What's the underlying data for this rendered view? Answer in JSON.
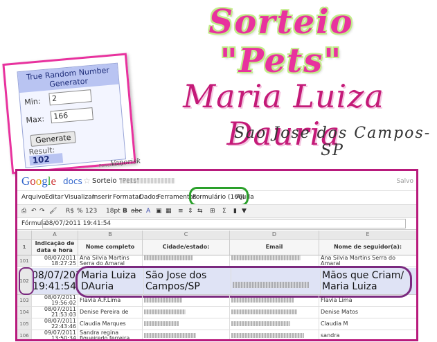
{
  "banner": {
    "title": "Sorteio \"Pets\"",
    "winner": "Maria Luiza Dauria",
    "city": "Sao Jose dos Campos-SP"
  },
  "rng": {
    "header": "True Random Number Generator",
    "min_label": "Min:",
    "min_value": "2",
    "max_label": "Max:",
    "max_value": "166",
    "button_label": "Generate",
    "result_label": "Result:",
    "result_value": "102",
    "powered": "Powered by",
    "signature": "Vanorisk"
  },
  "app": {
    "logo": [
      "G",
      "o",
      "o",
      "g",
      "l",
      "e"
    ],
    "docs": "docs",
    "doc_title": "Sorteio \"Pets\"",
    "saved": "Salvo"
  },
  "menu": [
    "Arquivo",
    "Editar",
    "Visualizar",
    "Inserir",
    "Formatar",
    "Dados",
    "Ferramentas",
    "Formulário (166)",
    "Ajuda"
  ],
  "toolbar": {
    "currency": "R$",
    "percent": "%",
    "num_format": "123",
    "font_size": "18pt",
    "bold": "B",
    "strike": "abc",
    "sigma": "Σ"
  },
  "formula": {
    "label": "Fórmula:",
    "value": "08/07/2011 19:41:54"
  },
  "columns": [
    "A",
    "B",
    "C",
    "D",
    "E"
  ],
  "headers": {
    "rownum": "1",
    "date": "Indicação de data e hora",
    "name": "Nome completo",
    "city": "Cidade/estado:",
    "email": "Email",
    "follower": "Nome de seguidor(a):"
  },
  "rows": [
    {
      "num": "101",
      "date": "08/07/2011 18:27:25",
      "name": "Ana Silvia Martins Serra do Amaral",
      "follower": "Ana Silvia Martins Serra do Amaral"
    },
    {
      "num": "102",
      "date": "08/07/2011 19:41:54",
      "name": "Maria Luiza DAuria",
      "city": "São Jose dos Campos/SP",
      "follower": "Mãos que Criam/ Maria Luiza"
    },
    {
      "num": "103",
      "date": "08/07/2011 19:56:02",
      "name": "Flavia A.F.Lima",
      "follower": "Flavia Lima"
    },
    {
      "num": "104",
      "date": "08/07/2011 21:53:03",
      "name": "Denise Pereira de Matos",
      "follower": "Denise Matos"
    },
    {
      "num": "105",
      "date": "08/07/2011 22:43:46",
      "name": "Claudia Marques Macedo",
      "follower": "Claudia M"
    },
    {
      "num": "106",
      "date": "09/07/2011 13:50:34",
      "name": "Sandra regina figueiredo ferreira",
      "follower": "sandra"
    }
  ],
  "colors": {
    "pink": "#e8329e",
    "magenta": "#c41a78",
    "lime": "#c2ec8a",
    "frame": "#b81a7c",
    "highlight": "#7a2a7f",
    "green_circle": "#2aa02a"
  }
}
